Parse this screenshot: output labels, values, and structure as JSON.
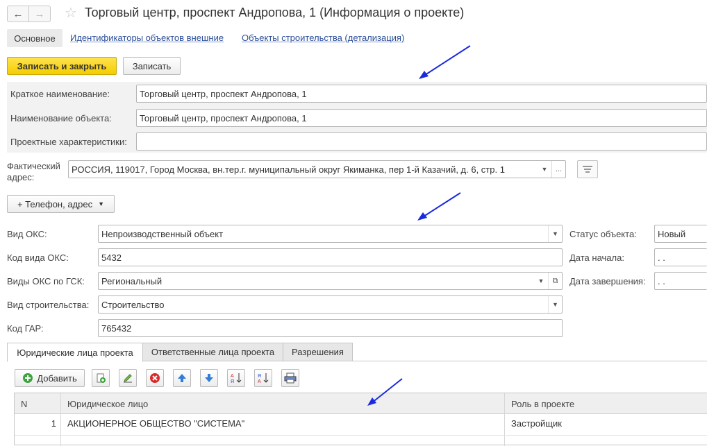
{
  "header": {
    "back_icon": "←",
    "forward_icon": "→",
    "star_icon": "☆",
    "title": "Торговый центр, проспект Андропова, 1 (Информация о проекте)"
  },
  "top_tabs": {
    "main": "Основное",
    "link1": "Идентификаторы объектов внешние",
    "link2": "Объекты строительства (детализация)"
  },
  "toolbar": {
    "save_close": "Записать и закрыть",
    "save": "Записать"
  },
  "form": {
    "short_name_label": "Краткое наименование:",
    "short_name_value": "Торговый центр, проспект Андропова, 1",
    "object_name_label": "Наименование объекта:",
    "object_name_value": "Торговый центр, проспект Андропова, 1",
    "project_chars_label": "Проектные характеристики:",
    "project_chars_value": "",
    "address_label_1": "Фактический",
    "address_label_2": "адрес:",
    "address_value": "РОССИЯ, 119017, Город Москва, вн.тер.г. муниципальный округ Якиманка, пер 1-й Казачий, д. 6, стр. 1",
    "phone_button": "+ Телефон, адрес",
    "oks_type_label": "Вид ОКС:",
    "oks_type_value": "Непроизводственный объект",
    "oks_code_label": "Код вида ОКС:",
    "oks_code_value": "5432",
    "oks_gsk_label": "Виды ОКС по ГСК:",
    "oks_gsk_value": "Региональный",
    "construction_type_label": "Вид строительства:",
    "construction_type_value": "Строительство",
    "gar_label": "Код ГАР:",
    "gar_value": "765432",
    "status_label": "Статус объекта:",
    "status_value": "Новый",
    "start_label": "Дата начала:",
    "start_value": " .  .",
    "end_label": "Дата завершения:",
    "end_value": " .  ."
  },
  "bottom_tabs": [
    "Юридические лица проекта",
    "Ответственные лица проекта",
    "Разрешения"
  ],
  "table_toolbar": {
    "add_label": "Добавить",
    "icons": [
      "add-copy-icon",
      "edit-icon",
      "delete-icon",
      "move-up-icon",
      "move-down-icon",
      "sort-asc-icon",
      "sort-desc-icon",
      "print-icon"
    ]
  },
  "table": {
    "headers": [
      "N",
      "Юридическое лицо",
      "Роль в проекте"
    ],
    "rows": [
      {
        "n": "1",
        "entity": "АКЦИОНЕРНОЕ ОБЩЕСТВО \"СИСТЕМА\"",
        "role": "Застройщик"
      }
    ]
  },
  "colors": {
    "primary_button": "#f4cd00",
    "link": "#2b4f9a",
    "annotation_arrow": "#1a2adf"
  }
}
